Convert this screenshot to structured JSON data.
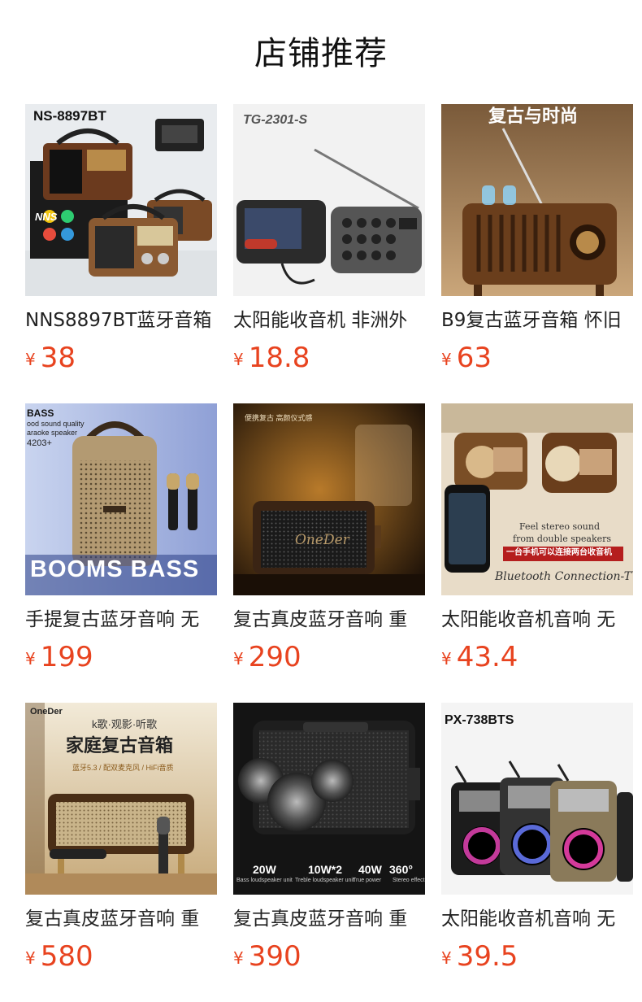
{
  "page": {
    "title": "店铺推荐"
  },
  "currency_symbol": "¥",
  "products": [
    {
      "name": "NNS8897BT蓝牙音箱",
      "price": "38",
      "overlay": [
        "NS-8897BT",
        "NNS"
      ]
    },
    {
      "name": "太阳能收音机 非洲外",
      "price": "18.8",
      "overlay": [
        "TG-2301-S"
      ]
    },
    {
      "name": "B9复古蓝牙音箱 怀旧",
      "price": "63",
      "overlay": [
        "复古与时尚"
      ]
    },
    {
      "name": "手提复古蓝牙音响 无",
      "price": "199",
      "overlay": [
        "BASS",
        "ood sound quality",
        "araoke speaker",
        "4203+",
        "BOOMS BASS"
      ]
    },
    {
      "name": "复古真皮蓝牙音响 重",
      "price": "290",
      "overlay": [
        "便携复古  高颜仪式感",
        "OneDer"
      ]
    },
    {
      "name": "太阳能收音机音响 无",
      "price": "43.4",
      "overlay": [
        "Feel stereo sound",
        "from double speakers",
        "一台手机可以连接两台收音机",
        "Bluetooth Connection-TWS"
      ]
    },
    {
      "name": "复古真皮蓝牙音响 重",
      "price": "580",
      "overlay": [
        "OneDer",
        "k歌·观影·听歌",
        "家庭复古音箱",
        "蓝牙5.3 / 配双麦克风 / HiFi音质"
      ]
    },
    {
      "name": "复古真皮蓝牙音响 重",
      "price": "390",
      "overlay": [
        "20W",
        "Bass loudspeaker unit",
        "10W*2",
        "Treble loudspeaker unit",
        "40W",
        "True power",
        "360°",
        "Stereo effect"
      ]
    },
    {
      "name": "太阳能收音机音响 无",
      "price": "39.5",
      "overlay": [
        "PX-738BTS"
      ]
    }
  ]
}
